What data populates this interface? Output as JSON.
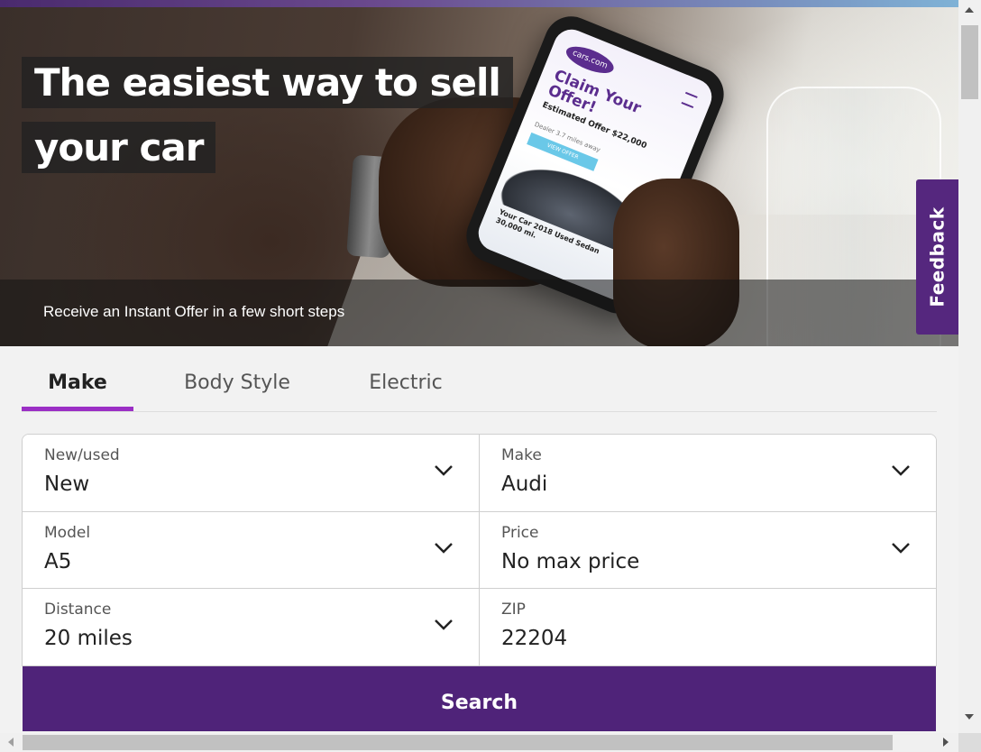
{
  "hero": {
    "title": "The easiest way to sell your car",
    "caption": "Receive an Instant Offer in a few short steps",
    "phone": {
      "logo": "cars.com",
      "headline": "Claim Your Offer!",
      "estimate": "Estimated Offer $22,000",
      "distance": "Dealer 3.7 miles away",
      "button": "VIEW OFFER",
      "car": "Your Car 2018 Used Sedan 30,000 mi."
    }
  },
  "feedback": {
    "label": "Feedback"
  },
  "tabs": [
    {
      "label": "Make",
      "active": true
    },
    {
      "label": "Body Style",
      "active": false
    },
    {
      "label": "Electric",
      "active": false
    }
  ],
  "form": {
    "new_used": {
      "label": "New/used",
      "value": "New"
    },
    "make": {
      "label": "Make",
      "value": "Audi"
    },
    "model": {
      "label": "Model",
      "value": "A5"
    },
    "price": {
      "label": "Price",
      "value": "No max price"
    },
    "distance": {
      "label": "Distance",
      "value": "20 miles"
    },
    "zip": {
      "label": "ZIP",
      "value": "22204"
    }
  },
  "search": {
    "label": "Search"
  },
  "colors": {
    "accent_purple": "#4f2379",
    "tab_underline": "#9b2fc5",
    "feedback_bg": "#55277e"
  },
  "icons": {
    "chevron": "chevron-down-icon"
  }
}
